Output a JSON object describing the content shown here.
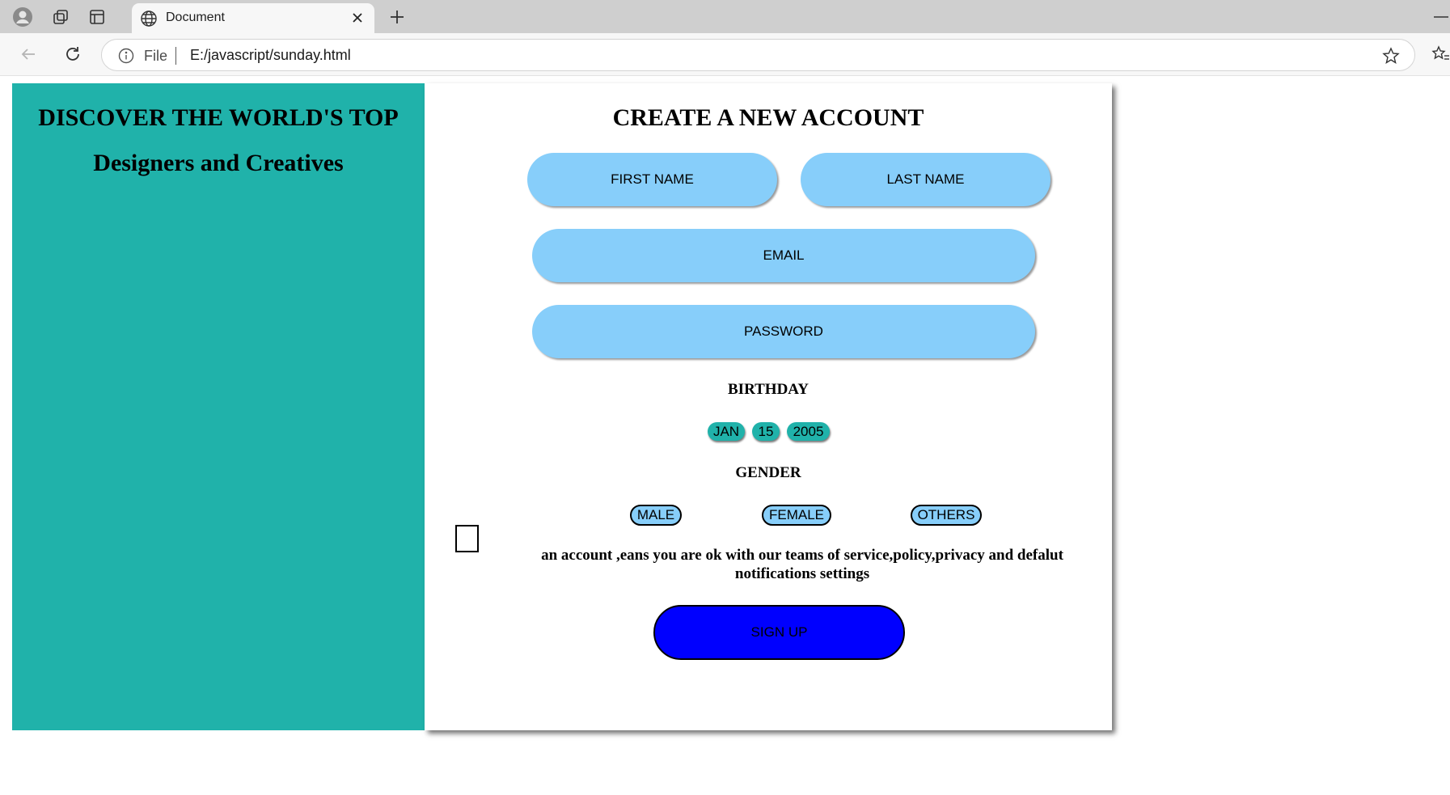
{
  "browser": {
    "tab_title": "Document",
    "address_prefix": "File",
    "url": "E:/javascript/sunday.html"
  },
  "page": {
    "left_panel": {
      "heading": "DISCOVER THE WORLD'S TOP",
      "subheading": "Designers and Creatives",
      "background_color": "#20b2aa"
    },
    "form": {
      "title": "CREATE A NEW ACCOUNT",
      "first_name_placeholder": "FIRST NAME",
      "last_name_placeholder": "LAST NAME",
      "email_placeholder": "EMAIL",
      "password_placeholder": "PASSWORD",
      "input_color": "#87cefa",
      "birthday": {
        "label": "BIRTHDAY",
        "month": "JAN",
        "day": "15",
        "year": "2005"
      },
      "gender": {
        "label": "GENDER",
        "options": [
          "MALE",
          "FEMALE",
          "OTHERS"
        ]
      },
      "terms_text": "an account ,eans you are ok with our teams of service,policy,privacy and defalut notifications settings",
      "signup_label": "SIGN UP",
      "signup_color": "#0000ff"
    }
  }
}
